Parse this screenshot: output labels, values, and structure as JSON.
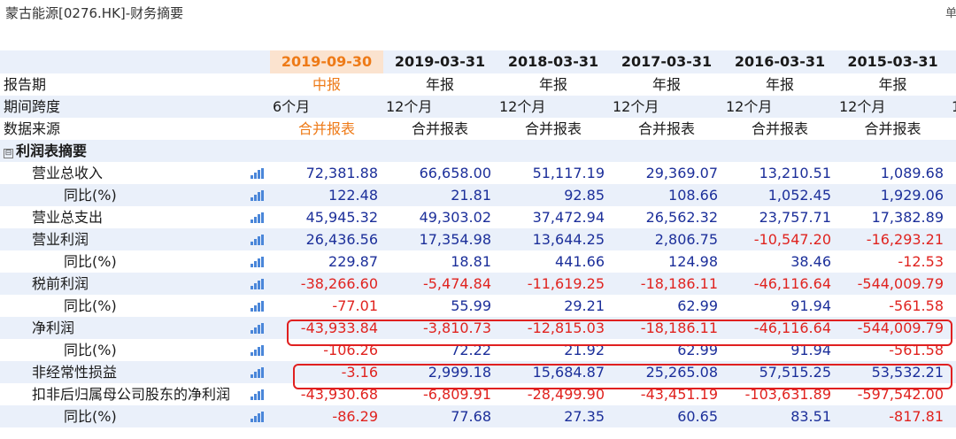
{
  "title": "蒙古能源[0276.HK]-财务摘要",
  "unit_fragment": "单",
  "columns": [
    "2019-09-30",
    "2019-03-31",
    "2018-03-31",
    "2017-03-31",
    "2016-03-31",
    "2015-03-31"
  ],
  "meta": [
    {
      "label": "报告期",
      "values": [
        "中报",
        "年报",
        "年报",
        "年报",
        "年报",
        "年报"
      ]
    },
    {
      "label": "期间跨度",
      "values": [
        "6个月",
        "12个月",
        "12个月",
        "12个月",
        "12个月",
        "12个月"
      ],
      "overflow": "1"
    },
    {
      "label": "数据来源",
      "values": [
        "合并报表",
        "合并报表",
        "合并报表",
        "合并报表",
        "合并报表",
        "合并报表"
      ]
    }
  ],
  "section": {
    "label": "利润表摘要",
    "toggle": "⊟"
  },
  "rows": [
    {
      "label": "营业总收入",
      "indent": 1,
      "values": [
        "72,381.88",
        "66,658.00",
        "51,117.19",
        "29,369.07",
        "13,210.51",
        "1,089.68"
      ]
    },
    {
      "label": "同比(%)",
      "indent": 2,
      "values": [
        "122.48",
        "21.81",
        "92.85",
        "108.66",
        "1,052.45",
        "1,929.06"
      ]
    },
    {
      "label": "营业总支出",
      "indent": 1,
      "values": [
        "45,945.32",
        "49,303.02",
        "37,472.94",
        "26,562.32",
        "23,757.71",
        "17,382.89"
      ]
    },
    {
      "label": "营业利润",
      "indent": 1,
      "values": [
        "26,436.56",
        "17,354.98",
        "13,644.25",
        "2,806.75",
        "-10,547.20",
        "-16,293.21"
      ]
    },
    {
      "label": "同比(%)",
      "indent": 2,
      "values": [
        "229.87",
        "18.81",
        "441.66",
        "124.98",
        "38.46",
        "-12.53"
      ]
    },
    {
      "label": "税前利润",
      "indent": 1,
      "values": [
        "-38,266.60",
        "-5,474.84",
        "-11,619.25",
        "-18,186.11",
        "-46,116.64",
        "-544,009.79"
      ]
    },
    {
      "label": "同比(%)",
      "indent": 2,
      "values": [
        "-77.01",
        "55.99",
        "29.21",
        "62.99",
        "91.94",
        "-561.58"
      ]
    },
    {
      "label": "净利润",
      "indent": 1,
      "values": [
        "-43,933.84",
        "-3,810.73",
        "-12,815.03",
        "-18,186.11",
        "-46,116.64",
        "-544,009.79"
      ],
      "boxed": true
    },
    {
      "label": "同比(%)",
      "indent": 2,
      "values": [
        "-106.26",
        "72.22",
        "21.92",
        "62.99",
        "91.94",
        "-561.58"
      ]
    },
    {
      "label": "非经常性损益",
      "indent": 1,
      "values": [
        "-3.16",
        "2,999.18",
        "15,684.87",
        "25,265.08",
        "57,515.25",
        "53,532.21"
      ],
      "boxed": true
    },
    {
      "label": "扣非后归属母公司股东的净利润",
      "indent": 1,
      "values": [
        "-43,930.68",
        "-6,809.91",
        "-28,499.90",
        "-43,451.19",
        "-103,631.89",
        "-597,542.00"
      ]
    },
    {
      "label": "同比(%)",
      "indent": 2,
      "values": [
        "-86.29",
        "77.68",
        "27.35",
        "60.65",
        "83.51",
        "-817.81"
      ]
    }
  ],
  "colors": {
    "highlight": "#ee7a17",
    "negative": "#e0231f",
    "positive": "#1c2f9a",
    "box": "#e02020"
  },
  "icon": "bar-chart-icon"
}
